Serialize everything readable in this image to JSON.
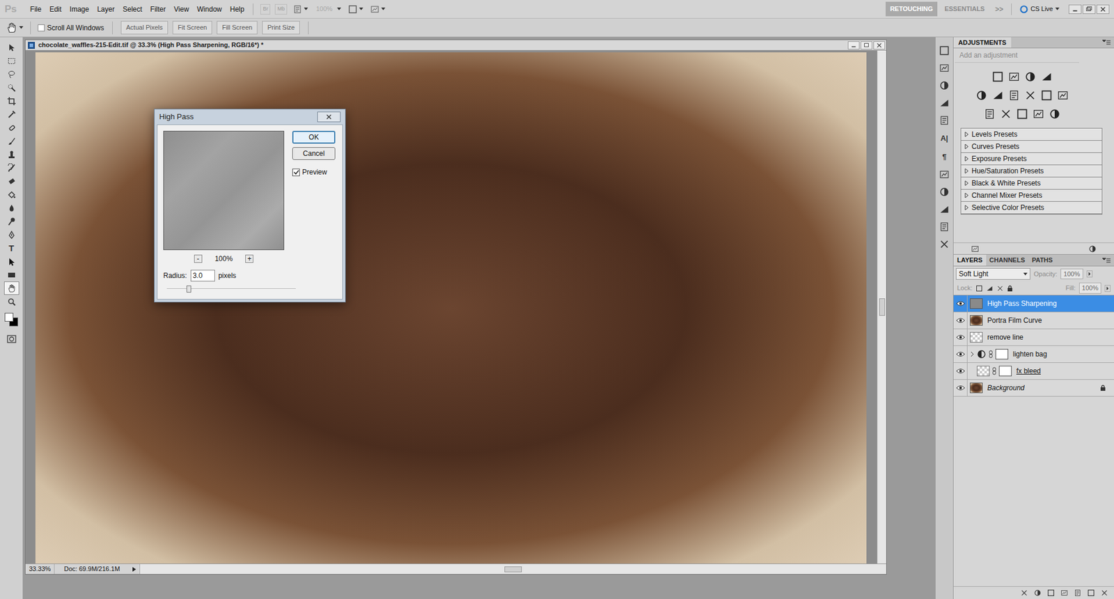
{
  "app": {
    "logo": "Ps",
    "menus": [
      "File",
      "Edit",
      "Image",
      "Layer",
      "Select",
      "Filter",
      "View",
      "Window",
      "Help"
    ],
    "launchers": [
      "Br",
      "Mb"
    ],
    "zoom": "100%",
    "zoom_disabled": true,
    "workspaces": [
      {
        "label": "RETOUCHING",
        "selected": true
      },
      {
        "label": "ESSENTIALS",
        "selected": false
      }
    ],
    "more": ">>",
    "cs_live": "CS Live"
  },
  "options_bar": {
    "scroll_all": {
      "label": "Scroll All Windows",
      "checked": false
    },
    "buttons": [
      "Actual Pixels",
      "Fit Screen",
      "Fill Screen",
      "Print Size"
    ]
  },
  "tools": [
    {
      "kind": "icon",
      "selected": false
    },
    {
      "kind": "icon",
      "selected": false
    },
    {
      "kind": "icon",
      "selected": false
    },
    {
      "kind": "icon",
      "selected": false
    },
    {
      "kind": "icon",
      "selected": false
    },
    {
      "kind": "icon",
      "selected": false
    },
    {
      "kind": "icon",
      "selected": false
    },
    {
      "kind": "icon",
      "selected": false
    },
    {
      "kind": "icon",
      "selected": false
    },
    {
      "kind": "icon",
      "selected": false
    },
    {
      "kind": "icon",
      "selected": false
    },
    {
      "kind": "icon",
      "selected": false
    },
    {
      "kind": "icon",
      "selected": false
    },
    {
      "kind": "icon",
      "selected": false
    },
    {
      "kind": "icon",
      "selected": false
    },
    {
      "kind": "glyph",
      "label": "T",
      "selected": false
    },
    {
      "kind": "icon",
      "selected": false
    },
    {
      "kind": "icon",
      "selected": false
    },
    {
      "kind": "icon",
      "selected": true
    },
    {
      "kind": "icon",
      "selected": false
    }
  ],
  "colors": {
    "foreground": "#ffffff",
    "background": "#000000"
  },
  "document": {
    "title": "chocolate_waffles-215-Edit.tif @ 33.3% (High Pass Sharpening, RGB/16*) *",
    "zoom": "33.33%",
    "info": "Doc: 69.9M/216.1M"
  },
  "dialog": {
    "title": "High Pass",
    "ok": "OK",
    "cancel": "Cancel",
    "preview": {
      "label": "Preview",
      "checked": true
    },
    "zoom_out": "-",
    "zoom": "100%",
    "zoom_in": "+",
    "radius_label": "Radius:",
    "radius": "3.0",
    "unit": "pixels",
    "level": 0.17
  },
  "dock": [
    {
      "kind": "icon"
    },
    {
      "kind": "icon"
    },
    {
      "kind": "icon"
    },
    {
      "kind": "icon"
    },
    {
      "kind": "icon"
    },
    {
      "kind": "glyph",
      "label": "A|"
    },
    {
      "kind": "glyph",
      "label": "¶"
    },
    {
      "kind": "icon"
    },
    {
      "kind": "icon"
    },
    {
      "kind": "icon"
    },
    {
      "kind": "icon"
    },
    {
      "kind": "icon"
    }
  ],
  "adjustments": {
    "title": "ADJUSTMENTS",
    "hint": "Add an adjustment",
    "presets": [
      "Levels Presets",
      "Curves Presets",
      "Exposure Presets",
      "Hue/Saturation Presets",
      "Black & White Presets",
      "Channel Mixer Presets",
      "Selective Color Presets"
    ]
  },
  "layers": {
    "tabs": [
      {
        "label": "LAYERS",
        "selected": true
      },
      {
        "label": "CHANNELS",
        "selected": false
      },
      {
        "label": "PATHS",
        "selected": false
      }
    ],
    "blend_mode": "Soft Light",
    "opacity_label": "Opacity:",
    "opacity": "100%",
    "lock_label": "Lock:",
    "fill_label": "Fill:",
    "fill": "100%",
    "items": [
      {
        "name": "High Pass Sharpening",
        "visible": true,
        "selected": true,
        "locked": false,
        "kind": "gray",
        "emphasis": "none"
      },
      {
        "name": "Portra Film Curve",
        "visible": true,
        "selected": false,
        "locked": false,
        "kind": "photo",
        "emphasis": "none"
      },
      {
        "name": "remove line",
        "visible": true,
        "selected": false,
        "locked": false,
        "kind": "transparent",
        "emphasis": "none"
      },
      {
        "name": "lighten bag",
        "visible": true,
        "selected": false,
        "locked": false,
        "kind": "adjustment-mask",
        "emphasis": "none"
      },
      {
        "name": "fx bleed",
        "visible": true,
        "selected": false,
        "locked": false,
        "kind": "transparent-mask",
        "emphasis": "underline"
      },
      {
        "name": "Background",
        "visible": true,
        "selected": false,
        "locked": true,
        "kind": "photo",
        "emphasis": "italic"
      }
    ]
  }
}
